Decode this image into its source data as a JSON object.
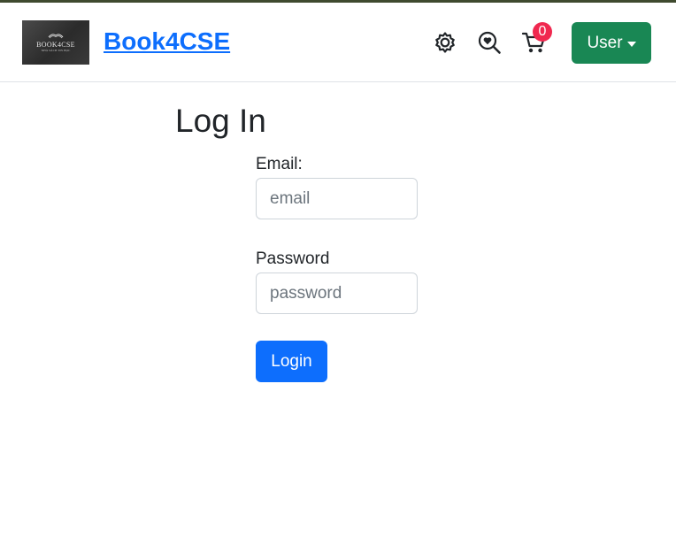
{
  "header": {
    "logo_text": "BOOK4CSE",
    "logo_subtext": "NHÀ SÁCH TIN HỌC",
    "brand": "Book4CSE",
    "cart_count": "0",
    "user_label": "User",
    "icons": [
      "gear-icon",
      "search-heart-icon",
      "cart-icon"
    ]
  },
  "login": {
    "title": "Log In",
    "email_label": "Email:",
    "email_placeholder": "email",
    "email_value": "",
    "password_label": "Password",
    "password_placeholder": "password",
    "password_value": "",
    "submit_label": "Login"
  },
  "colors": {
    "brand_link": "#0d6efd",
    "user_button": "#198754",
    "login_button": "#0d6efd",
    "cart_badge": "#f0284f",
    "top_border": "#3f4a2f"
  }
}
